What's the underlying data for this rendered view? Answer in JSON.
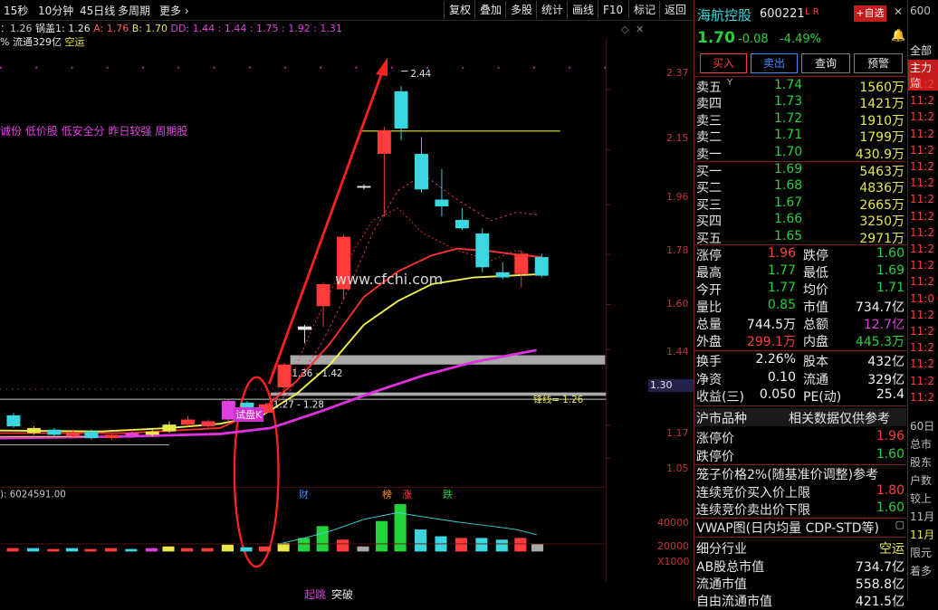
{
  "toolbar": {
    "periods": [
      "15秒",
      "10分钟",
      "45日线",
      "多周期"
    ],
    "more": "更多",
    "buttons": [
      "复权",
      "叠加",
      "多股",
      "统计",
      "画线",
      "F10",
      "标记",
      "返回"
    ]
  },
  "indicators": {
    "line1_prefix": "：1.26",
    "line1_name": "锅盖1",
    "line1_a": ": 1.26",
    "line1_b_label": "A",
    "line1_b": ": 1.76",
    "line1_c_label": "B",
    "line1_c": ": 1.70",
    "line1_dd_label": "DD",
    "line1_dd": ": 1.44 : 1.44 : 1.75 : 1.92 : 1.31",
    "line2_prefix": "% 流通329亿",
    "line2_tag": "空运",
    "tags": "诚份 低价股 低安全分 昨日较强 周期股"
  },
  "chart": {
    "watermark": "www.cfchi.com",
    "peak_label": "2.44",
    "price_ticks": [
      "2.37",
      "2.15",
      "1.96",
      "1.78",
      "1.60",
      "1.44",
      "1.17",
      "1.05"
    ],
    "current_price_tag": "1.30",
    "range_label_1": "1.36 - 1.42",
    "range_label_2": "1.27 - 1.28",
    "lock_line_label": "锋线= 1.26",
    "test_label": "试盘K",
    "event_labels": [
      "财",
      "榜",
      "涨",
      "跌"
    ],
    "volume_label": "): 6024591.00",
    "volume_ticks": [
      "40000",
      "20000",
      "X1000"
    ],
    "bottom_labels": [
      "起跳",
      "突破"
    ]
  },
  "stock": {
    "name": "海航控股",
    "code": "600221",
    "flags": "L R",
    "add_watch": "+自选",
    "price": "1.70",
    "change": "-0.08",
    "change_pct": "-4.49%",
    "actions": [
      "买入",
      "卖出",
      "查询",
      "预警"
    ],
    "asks": [
      {
        "label": "卖五",
        "mark": "Y",
        "price": "1.74",
        "vol": "1560万"
      },
      {
        "label": "卖四",
        "mark": "",
        "price": "1.73",
        "vol": "1421万"
      },
      {
        "label": "卖三",
        "mark": "",
        "price": "1.72",
        "vol": "1910万"
      },
      {
        "label": "卖二",
        "mark": "",
        "price": "1.71",
        "vol": "1799万"
      },
      {
        "label": "卖一",
        "mark": "",
        "price": "1.70",
        "vol": "430.9万"
      }
    ],
    "bids": [
      {
        "label": "买一",
        "price": "1.69",
        "vol": "5463万"
      },
      {
        "label": "买二",
        "price": "1.68",
        "vol": "4836万"
      },
      {
        "label": "买三",
        "price": "1.67",
        "vol": "2665万"
      },
      {
        "label": "买四",
        "price": "1.66",
        "vol": "3250万"
      },
      {
        "label": "买五",
        "price": "1.65",
        "vol": "2971万"
      }
    ],
    "stats": [
      {
        "l1": "涨停",
        "v1": "1.96",
        "c1": "red",
        "l2": "跌停",
        "v2": "1.60",
        "c2": "green"
      },
      {
        "l1": "最高",
        "v1": "1.77",
        "c1": "green",
        "l2": "最低",
        "v2": "1.69",
        "c2": "green"
      },
      {
        "l1": "今开",
        "v1": "1.77",
        "c1": "green",
        "l2": "均价",
        "v2": "1.71",
        "c2": "green"
      },
      {
        "l1": "量比",
        "v1": "0.85",
        "c1": "green",
        "l2": "市值",
        "v2": "734.7亿",
        "c2": "white"
      },
      {
        "l1": "总量",
        "v1": "744.5万",
        "c1": "white",
        "l2": "总额",
        "v2": "12.7亿",
        "c2": "magenta"
      },
      {
        "l1": "外盘",
        "v1": "299.1万",
        "c1": "red",
        "l2": "内盘",
        "v2": "445.3万",
        "c2": "green"
      }
    ],
    "fund": [
      {
        "l1": "换手",
        "v1": "2.26%",
        "l2": "股本",
        "v2": "432亿"
      },
      {
        "l1": "净资",
        "v1": "0.10",
        "l2": "流通",
        "v2": "329亿"
      },
      {
        "l1": "收益(三)",
        "v1": "0.050",
        "l2": "PE(动)",
        "v2": "25.4"
      }
    ],
    "market_title": "沪市品种",
    "market_note": "相关数据仅供参考",
    "limit_up_label": "涨停价",
    "limit_up": "1.96",
    "limit_down_label": "跌停价",
    "limit_down": "1.60",
    "cage_label": "笼子价格2%(随基准价调整)参考",
    "auction_up_label": "连续竞价买入价上限",
    "auction_up": "1.80",
    "auction_down_label": "连续竞价卖出价下限",
    "auction_down": "1.60",
    "vwap_label": "VWAP图(日内均量 CDP-STD等)",
    "industry_label": "细分行业",
    "industry": "空运",
    "ab_label": "AB股总市值",
    "ab": "734.7亿",
    "float_label": "流通市值",
    "float": "558.8亿",
    "free_label": "自由流通市值",
    "free": "421.5亿"
  },
  "far_right": {
    "top": "600",
    "tabs": [
      "全部",
      "主力监"
    ],
    "times": [
      "11:2",
      "11:2",
      "11:2",
      "11:2",
      "11:2",
      "11:2",
      "11:2",
      "11:2",
      "11:2",
      "11:2",
      "11:2",
      "11:2",
      "11:2",
      "11:0",
      "11:2",
      "11:2",
      "11:2",
      "11:2",
      "11:2",
      "11:2"
    ],
    "bottom": [
      "60日",
      "总市",
      "股东",
      "户数",
      "较上",
      "11月",
      "11月",
      "限元",
      "着多"
    ]
  },
  "colors": {
    "up": "#ff3b3b",
    "down": "#23d33c",
    "accent": "#ff2a2a",
    "vol_line": "#3ad7e0"
  }
}
